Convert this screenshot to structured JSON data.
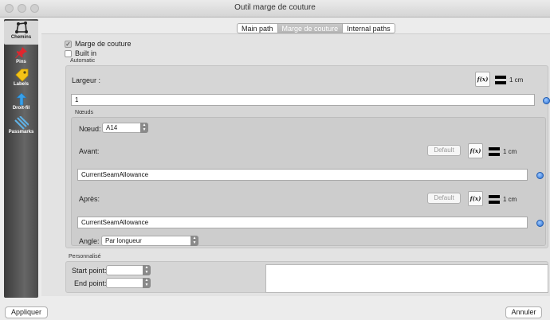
{
  "window": {
    "title": "Outil marge de couture"
  },
  "sidebar": {
    "items": [
      {
        "label": "Chemins",
        "icon": "chemins-icon"
      },
      {
        "label": "Pins",
        "icon": "pin-icon"
      },
      {
        "label": "Labels",
        "icon": "label-icon"
      },
      {
        "label": "Droit-fil",
        "icon": "grainline-icon"
      },
      {
        "label": "Passmarks",
        "icon": "passmarks-icon"
      }
    ]
  },
  "tabs": [
    {
      "label": "Main path"
    },
    {
      "label": "Marge de couture"
    },
    {
      "label": "Internal paths"
    }
  ],
  "options": {
    "marge_label": "Marge de couture",
    "builtin_label": "Built in"
  },
  "automatic": {
    "group_label": "Automatic",
    "largeur_label": "Largeur :",
    "largeur_unit": "1 cm",
    "largeur_value": "1",
    "fx_label": "f(x)"
  },
  "noeuds": {
    "group_label": "Nœuds",
    "noeud_label": "Nœud:",
    "noeud_value": "A14",
    "avant_label": "Avant:",
    "avant_default": "Default",
    "avant_unit": "1 cm",
    "avant_value": "CurrentSeamAllowance",
    "apres_label": "Après:",
    "apres_default": "Default",
    "apres_unit": "1 cm",
    "apres_value": "CurrentSeamAllowance",
    "angle_label": "Angle:",
    "angle_value": "Par longueur"
  },
  "custom": {
    "group_label": "Personnalisé",
    "start_label": "Start point:",
    "end_label": "End point:"
  },
  "footer": {
    "apply_label": "Appliquer",
    "cancel_label": "Annuler"
  },
  "colors": {
    "accent": "#2a6fd1",
    "sidebar": "#4a4a4a"
  }
}
